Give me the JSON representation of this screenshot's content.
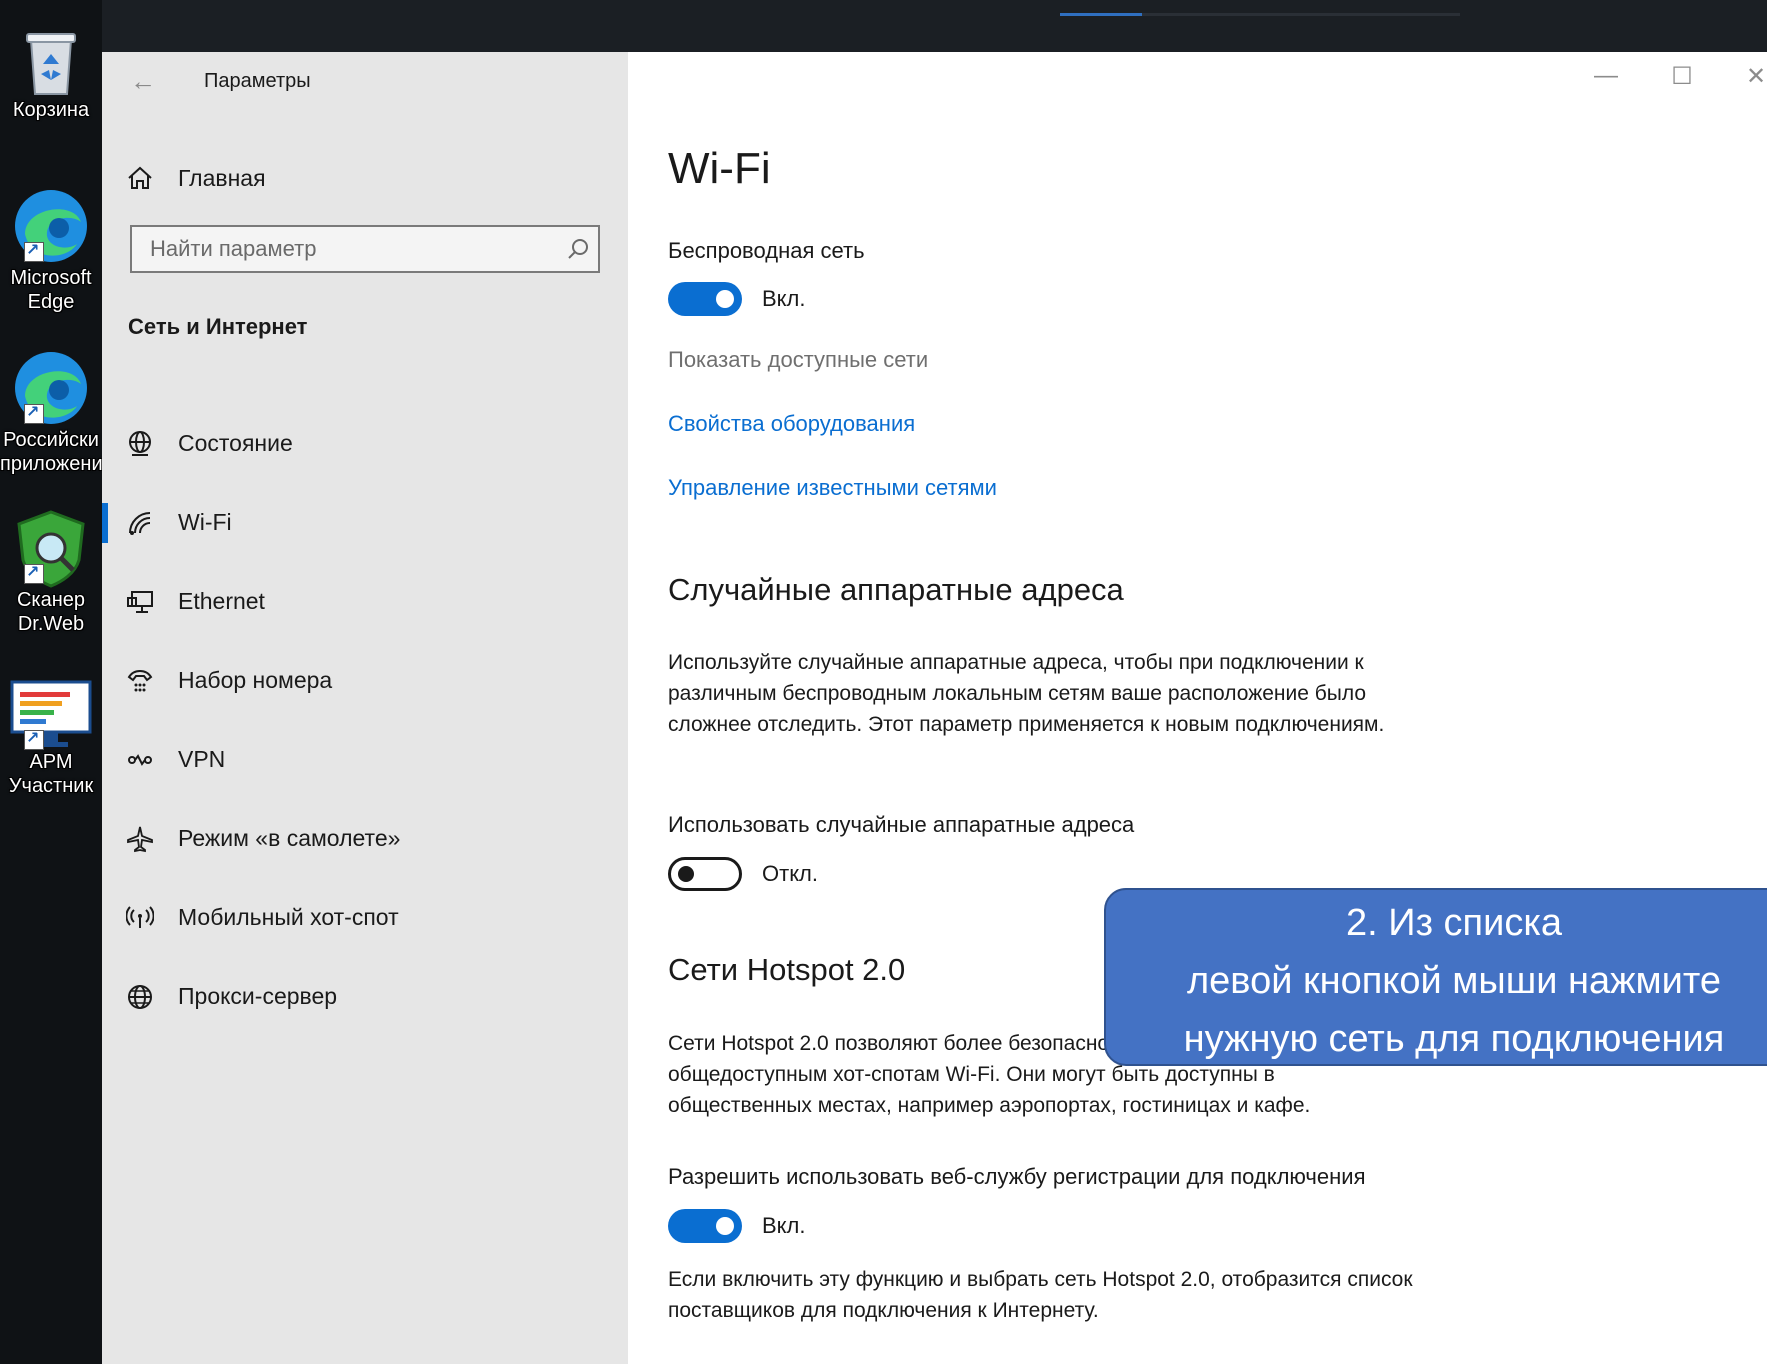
{
  "desktop": {
    "icons": [
      {
        "label_lines": [
          "Корзина"
        ]
      },
      {
        "label_lines": [
          "Microsoft",
          "Edge"
        ]
      },
      {
        "label_lines": [
          "Российски",
          "приложени"
        ]
      },
      {
        "label_lines": [
          "Сканер",
          "Dr.Web"
        ]
      },
      {
        "label_lines": [
          "АРМ",
          "Участник"
        ]
      }
    ]
  },
  "window": {
    "title": "Параметры",
    "controls": {
      "minimize": "—",
      "maximize": "☐",
      "close": "✕"
    }
  },
  "sidebar": {
    "home_label": "Главная",
    "search_placeholder": "Найти параметр",
    "section_title": "Сеть и Интернет",
    "items": [
      {
        "label": "Состояние",
        "icon": "globe-status-icon"
      },
      {
        "label": "Wi-Fi",
        "icon": "wifi-icon",
        "selected": true
      },
      {
        "label": "Ethernet",
        "icon": "ethernet-icon"
      },
      {
        "label": "Набор номера",
        "icon": "dialup-icon"
      },
      {
        "label": "VPN",
        "icon": "vpn-icon"
      },
      {
        "label": "Режим «в самолете»",
        "icon": "airplane-icon"
      },
      {
        "label": "Мобильный хот-спот",
        "icon": "hotspot-icon"
      },
      {
        "label": "Прокси-сервер",
        "icon": "globe-icon"
      }
    ]
  },
  "content": {
    "page_title": "Wi-Fi",
    "wireless_label": "Беспроводная сеть",
    "wireless_toggle": "Вкл.",
    "show_networks": "Показать доступные сети",
    "link_hardware": "Свойства оборудования",
    "link_known": "Управление известными сетями",
    "random_title": "Случайные аппаратные адреса",
    "random_desc": "Используйте случайные аппаратные адреса, чтобы при подключении к различным беспроводным локальным сетям ваше расположение было сложнее отследить. Этот параметр применяется к новым подключениям.",
    "random_label": "Использовать случайные аппаратные адреса",
    "random_toggle": "Откл.",
    "hotspot_title": "Сети Hotspot 2.0",
    "hotspot_desc": "Сети Hotspot 2.0 позволяют более безопасно подключаться к общедоступным хот-спотам Wi-Fi. Они могут быть доступны в общественных местах, например аэропортах, гостиницах и кафе.",
    "web_label": "Разрешить использовать веб-службу регистрации для подключения",
    "web_toggle": "Вкл.",
    "web_desc": "Если включить эту функцию и выбрать сеть Hotspot 2.0, отобразится список поставщиков для подключения к Интернету."
  },
  "callout": {
    "line1": "2. Из списка",
    "line2": "левой кнопкой мыши нажмите",
    "line3": "нужную сеть для подключения"
  },
  "colors": {
    "accent": "#0a6ed1",
    "sidebar_bg": "#e6e6e6",
    "callout_bg": "#4472c4"
  }
}
